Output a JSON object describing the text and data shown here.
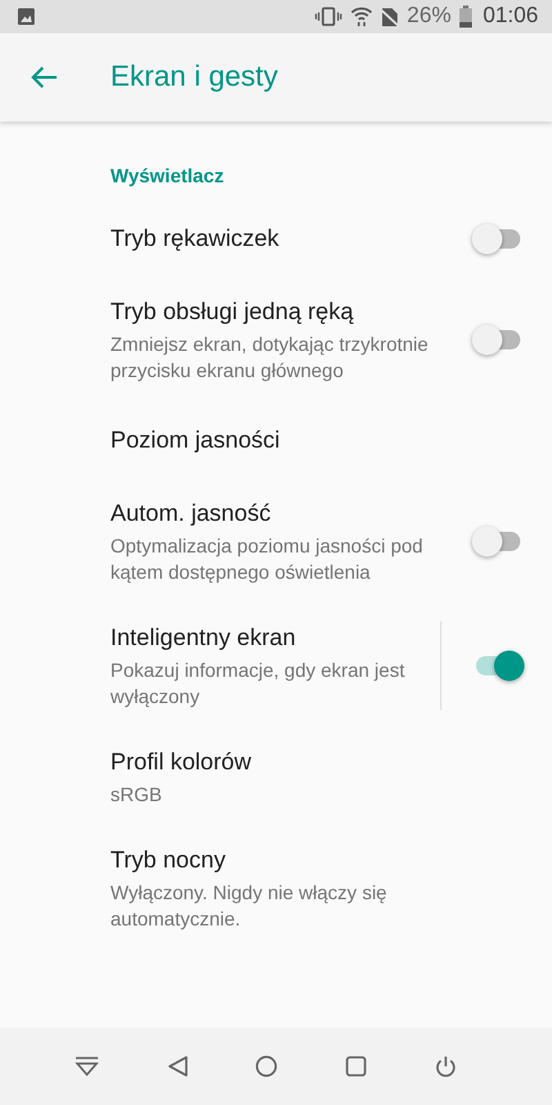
{
  "status_bar": {
    "battery": "26%",
    "time": "01:06"
  },
  "app_bar": {
    "title": "Ekran i gesty"
  },
  "section": "Wyświetlacz",
  "items": [
    {
      "kind": "switch",
      "title": "Tryb rękawiczek",
      "on": false
    },
    {
      "kind": "switch",
      "title": "Tryb obsługi jedną ręką",
      "subtitle": "Zmniejsz ekran, dotykając trzykrotnie przycisku ekranu głównego",
      "on": false
    },
    {
      "kind": "plain",
      "title": "Poziom jasności"
    },
    {
      "kind": "switch",
      "title": "Autom. jasność",
      "subtitle": "Optymalizacja poziomu jasności pod kątem dostępnego oświetlenia",
      "on": false
    },
    {
      "kind": "split-switch",
      "title": "Inteligentny ekran",
      "subtitle": "Pokazuj informacje, gdy ekran jest wyłączony",
      "on": true
    },
    {
      "kind": "plain",
      "title": "Profil kolorów",
      "subtitle": "sRGB"
    },
    {
      "kind": "plain",
      "title": "Tryb nocny",
      "subtitle": "Wyłączony. Nigdy nie włączy się automatycznie."
    }
  ]
}
